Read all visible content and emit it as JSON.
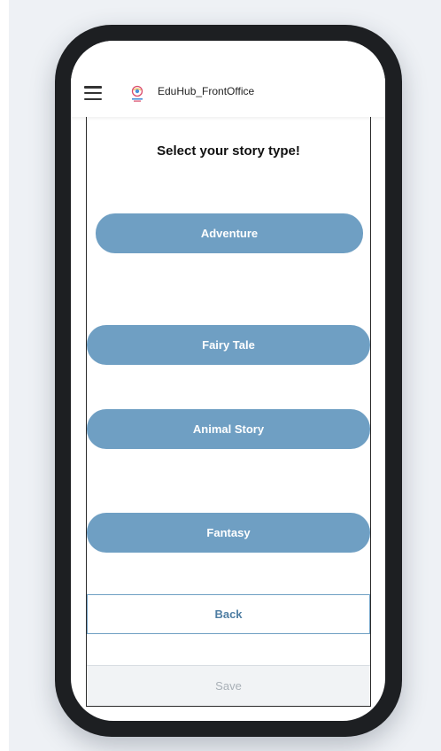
{
  "header": {
    "app_title": "EduHub_FrontOffice"
  },
  "page": {
    "heading": "Select your story type!"
  },
  "story_types": [
    "Adventure",
    "Fairy Tale",
    "Animal Story",
    "Fantasy"
  ],
  "actions": {
    "back_label": "Back",
    "save_label": "Save"
  },
  "colors": {
    "button_fill": "#6f9fc3",
    "phone_frame": "#1d1f22",
    "save_disabled_text": "#a9b0b7"
  },
  "icons": {
    "menu": "hamburger-menu-icon",
    "logo": "app-logo"
  }
}
